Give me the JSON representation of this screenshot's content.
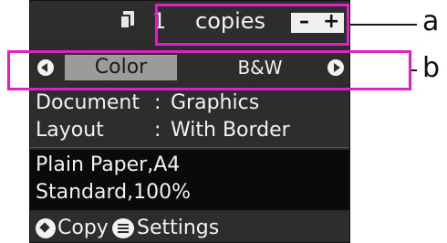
{
  "copies": {
    "count": "1",
    "label": "copies",
    "minus": "–",
    "plus": "+"
  },
  "mode": {
    "selected": "Color",
    "other": "B&W"
  },
  "settings": [
    {
      "key": "Document",
      "sep": ":",
      "value": "Graphics"
    },
    {
      "key": "Layout",
      "sep": ":",
      "value": "With Border"
    }
  ],
  "paper": {
    "line1": "Plain Paper,A4",
    "line2": "Standard,100%"
  },
  "bottom": {
    "copy_label": "Copy",
    "settings_label": "Settings"
  },
  "callouts": {
    "a": "a",
    "b": "b"
  },
  "colors": {
    "callout": "#e21fc7",
    "lcd_bg": "#2d2d2d",
    "highlight": "#9b9b9b"
  },
  "icons": [
    "copy-pages-icon",
    "arrow-left-icon",
    "arrow-right-icon",
    "start-diamond-icon",
    "menu-icon"
  ]
}
